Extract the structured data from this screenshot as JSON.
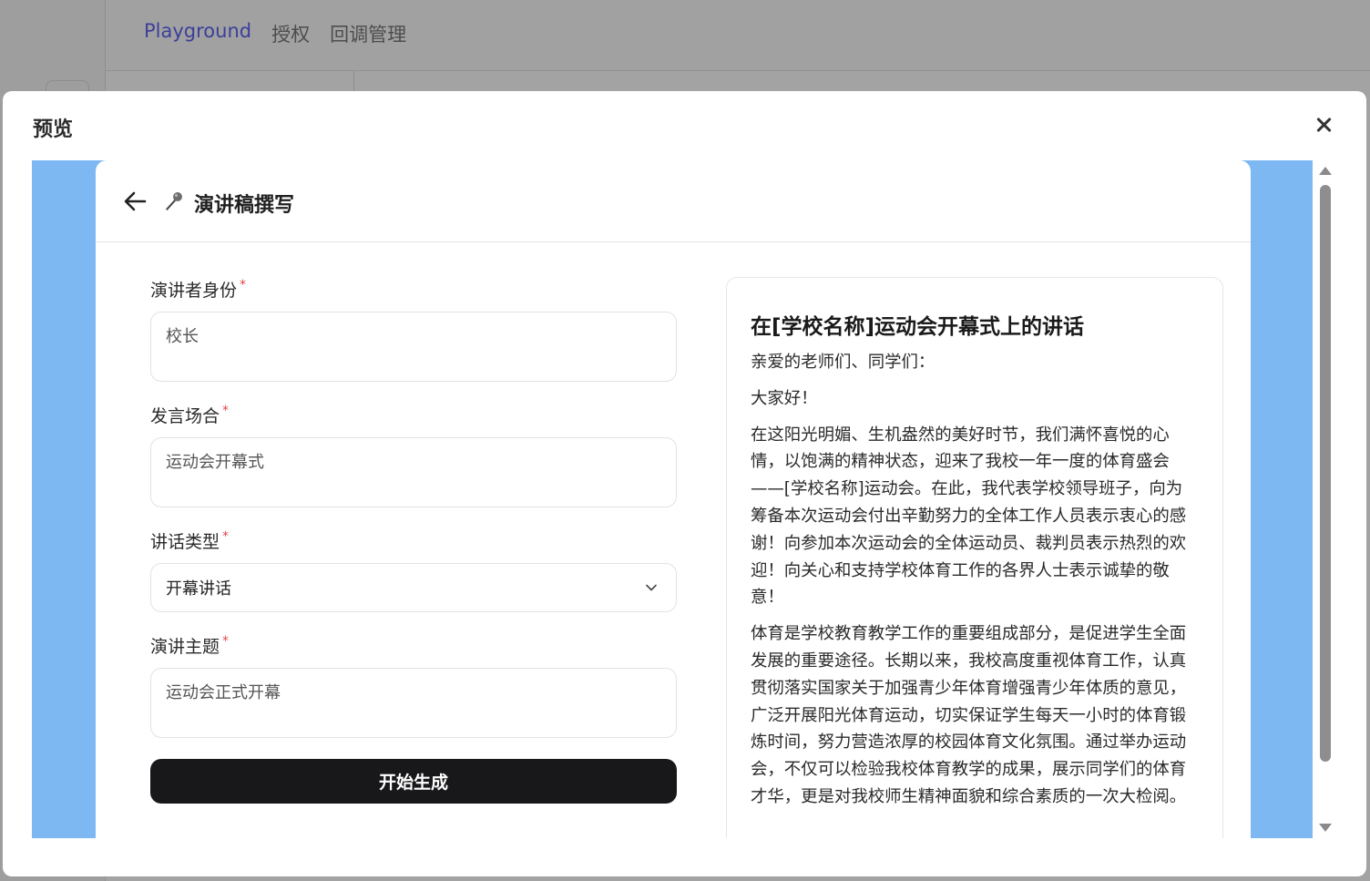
{
  "background": {
    "nav": [
      "Playground",
      "授权",
      "回调管理"
    ]
  },
  "modal": {
    "title": "预览",
    "close_icon": "close-icon"
  },
  "app": {
    "title": "演讲稿撰写",
    "back_icon": "arrow-left-icon",
    "title_icon": "microphone-icon"
  },
  "form": {
    "speaker": {
      "label": "演讲者身份",
      "required_mark": "*",
      "value": "校长"
    },
    "occasion": {
      "label": "发言场合",
      "required_mark": "*",
      "value": "运动会开幕式"
    },
    "type": {
      "label": "讲话类型",
      "required_mark": "*",
      "value": "开幕讲话"
    },
    "topic": {
      "label": "演讲主题",
      "required_mark": "*",
      "value": "运动会正式开幕"
    },
    "submit_label": "开始生成"
  },
  "output": {
    "title": "在[学校名称]运动会开幕式上的讲话",
    "paragraphs": [
      "亲爱的老师们、同学们：",
      "大家好！",
      "在这阳光明媚、生机盎然的美好时节，我们满怀喜悦的心情，以饱满的精神状态，迎来了我校一年一度的体育盛会——[学校名称]运动会。在此，我代表学校领导班子，向为筹备本次运动会付出辛勤努力的全体工作人员表示衷心的感谢！向参加本次运动会的全体运动员、裁判员表示热烈的欢迎！向关心和支持学校体育工作的各界人士表示诚挚的敬意！",
      "体育是学校教育教学工作的重要组成部分，是促进学生全面发展的重要途径。长期以来，我校高度重视体育工作，认真贯彻落实国家关于加强青少年体育增强青少年体质的意见，广泛开展阳光体育运动，切实保证学生每天一小时的体育锻炼时间，努力营造浓厚的校园体育文化氛围。通过举办运动会，不仅可以检验我校体育教学的成果，展示同学们的体育才华，更是对我校师生精神面貌和综合素质的一次大检阅。"
    ]
  },
  "colors": {
    "frame_bg": "#7db8f2",
    "button_bg": "#18181b",
    "required": "#e04848",
    "nav_active": "#3b3f9a"
  }
}
